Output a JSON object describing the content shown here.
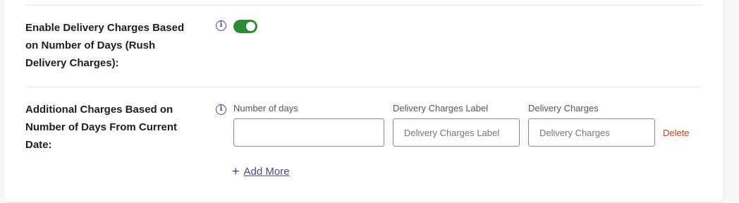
{
  "settings": {
    "rush_delivery": {
      "label": "Enable Delivery Charges Based on Number of Days (Rush Delivery Charges):",
      "enabled": true
    },
    "additional_charges": {
      "label": "Additional Charges Based on Number of Days From Current Date:",
      "fields": {
        "days": {
          "label": "Number of days",
          "value": "",
          "placeholder": ""
        },
        "charges_label": {
          "label": "Delivery Charges Label",
          "placeholder": "Delivery Charges Label"
        },
        "charges": {
          "label": "Delivery Charges",
          "placeholder": "Delivery Charges"
        }
      },
      "delete_label": "Delete",
      "add_more_label": "Add More"
    }
  },
  "icons": {
    "info": "info-icon",
    "plus": "plus-icon"
  },
  "colors": {
    "toggle_on": "#2e8a36",
    "accent": "#4b3fa3",
    "delete": "#c7411a"
  }
}
